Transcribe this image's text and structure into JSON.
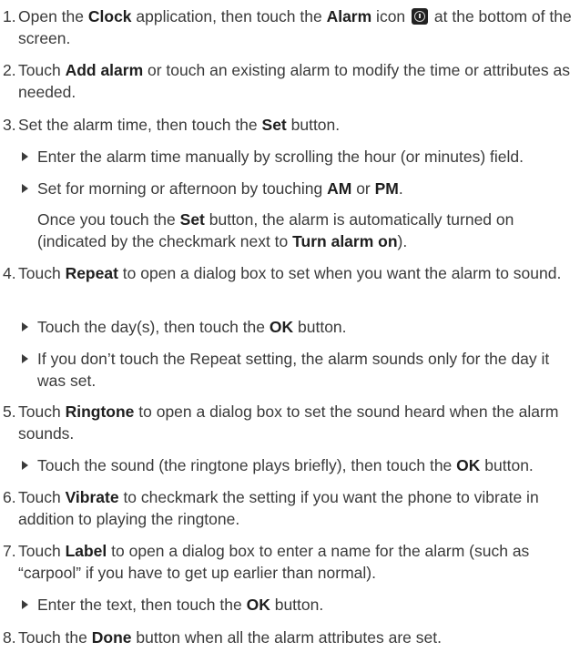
{
  "steps": [
    {
      "num": "1.",
      "pre": "Open the ",
      "b1": "Clock",
      "mid": " application, then touch the ",
      "b2": "Alarm",
      "post1": " icon",
      "post2": " at the bottom of the screen.",
      "icon": "alarm-clock-icon"
    },
    {
      "num": "2.",
      "pre": "Touch ",
      "b1": "Add alarm",
      "post": " or touch an existing alarm to modify the time or attributes as needed."
    },
    {
      "num": "3.",
      "pre": "Set the alarm time, then touch the ",
      "b1": "Set",
      "post": " button."
    },
    {
      "num": "4.",
      "pre": "Touch ",
      "b1": "Repeat",
      "post": " to open a dialog box to set when you want the alarm to sound."
    },
    {
      "num": "5.",
      "pre": "Touch ",
      "b1": "Ringtone",
      "post": " to open a dialog box to set the sound heard when the alarm sounds."
    },
    {
      "num": "6.",
      "pre": "Touch ",
      "b1": "Vibrate",
      "post": " to checkmark the setting if you want the phone to vibrate in addition to playing the ringtone."
    },
    {
      "num": "7.",
      "pre": "Touch ",
      "b1": "Label",
      "post": " to open a dialog box to enter a name for the alarm (such as “carpool” if you have to get up earlier than normal)."
    },
    {
      "num": "8.",
      "pre": "Touch the ",
      "b1": "Done",
      "post": " button when all the alarm attributes are set."
    }
  ],
  "bullets": {
    "s3a": {
      "text": "Enter the alarm time manually by scrolling the hour (or minutes) field."
    },
    "s3b": {
      "pre": "Set for morning or afternoon by touching ",
      "b1": "AM",
      "mid": " or ",
      "b2": "PM",
      "post": "."
    },
    "s3note": {
      "pre": "Once you touch the ",
      "b1": "Set",
      "mid": " button, the alarm is automatically turned on (indicated by the checkmark next to ",
      "b2": "Turn alarm on",
      "post": ")."
    },
    "s4a": {
      "pre": "Touch the day(s), then touch the ",
      "b1": "OK",
      "post": " button."
    },
    "s4b": {
      "text": "If you don’t touch the Repeat setting, the alarm sounds only for the day it was set."
    },
    "s5a": {
      "pre": "Touch the sound (the ringtone plays briefly), then touch the ",
      "b1": "OK",
      "post": " button."
    },
    "s7a": {
      "pre": "Enter the text, then touch the ",
      "b1": "OK",
      "post": " button."
    }
  }
}
